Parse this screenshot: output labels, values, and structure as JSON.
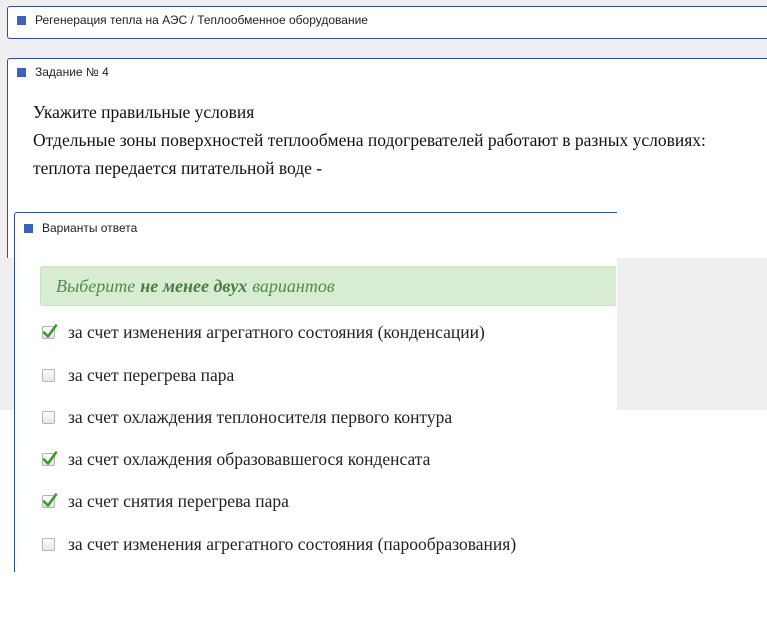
{
  "breadcrumb": {
    "text": "Регенерация тепла на АЭС / Теплообменное оборудование"
  },
  "task": {
    "title": "Задание № 4",
    "question_lines": [
      "Укажите правильные условия",
      "Отдельные зоны поверхностей теплообмена подогревателей работают в разных условиях:",
      "теплота передается питательной воде -"
    ]
  },
  "answers": {
    "title": "Варианты ответа",
    "hint": {
      "prefix": "Выберите",
      "emphasis": "не менее двух",
      "suffix": "вариантов"
    },
    "options": [
      {
        "label": "за счет изменения агрегатного состояния (конденсации)",
        "checked": true
      },
      {
        "label": "за счет перегрева пара",
        "checked": false
      },
      {
        "label": "за счет охлаждения теплоносителя первого контура",
        "checked": false
      },
      {
        "label": "за счет охлаждения образовавшегося конденсата",
        "checked": true
      },
      {
        "label": "за счет снятия перегрева пара",
        "checked": true
      },
      {
        "label": "за счет изменения агрегатного состояния (парообразования)",
        "checked": false
      }
    ]
  },
  "colors": {
    "accent": "#3a64b8",
    "panel_border": "#2f4f9a",
    "hint_background": "#d8ecd4",
    "hint_text": "#4f8f49",
    "check": "#3d9a2c"
  },
  "icons": {
    "section_marker": "blue-square-icon",
    "checked": "green-checkmark-icon"
  }
}
